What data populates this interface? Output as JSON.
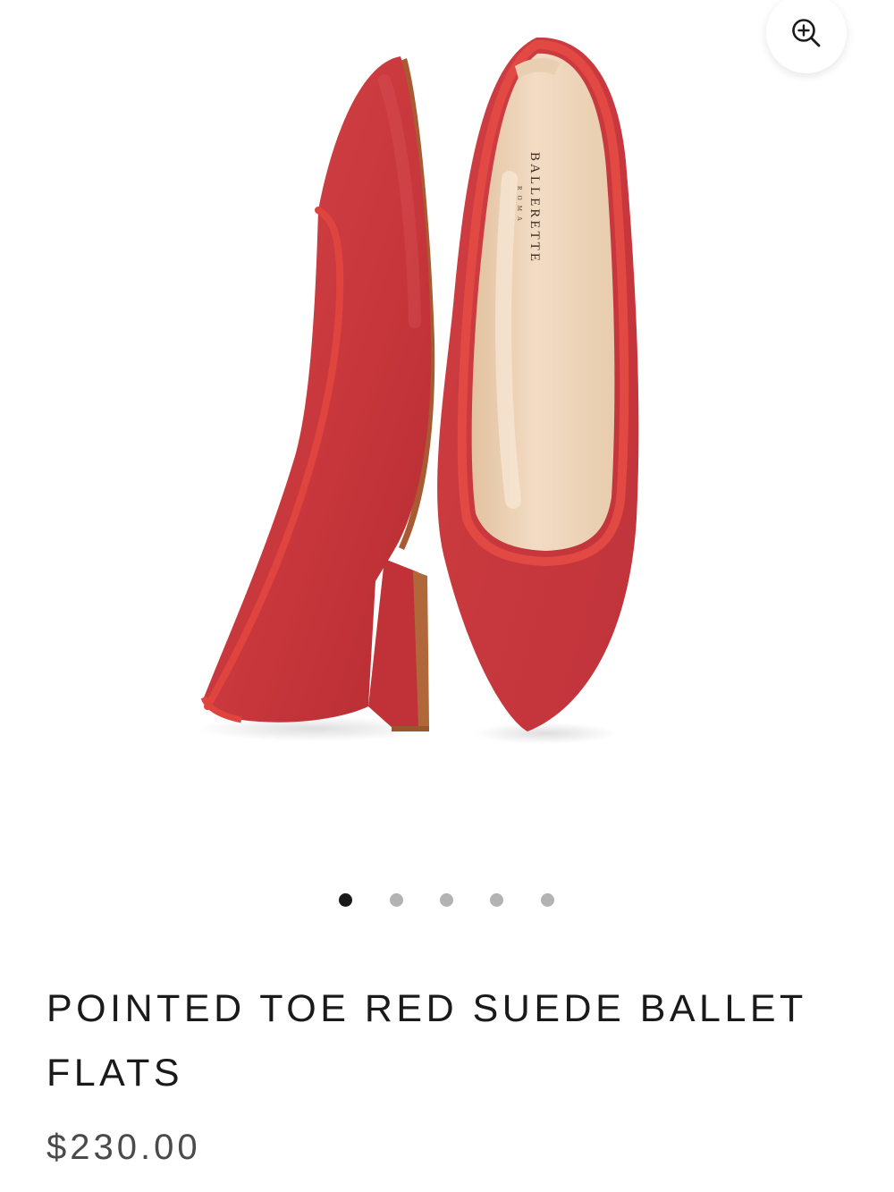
{
  "gallery": {
    "image_alt": "Red suede pointed toe ballet flats",
    "insole_brand": "BALLERETTE",
    "insole_subbrand": "ROMA",
    "zoom_icon": "zoom-in-icon",
    "slide_count": 5,
    "active_slide": 1
  },
  "product": {
    "title": "POINTED TOE RED SUEDE BALLET FLATS",
    "price": "$230.00"
  },
  "colors": {
    "suede": "#c8373c",
    "piping": "#e0443f",
    "insole": "#ecd3b6",
    "sole": "#b0683a",
    "dot_active": "#1a1a1a",
    "dot_inactive": "#b3b3b3"
  }
}
